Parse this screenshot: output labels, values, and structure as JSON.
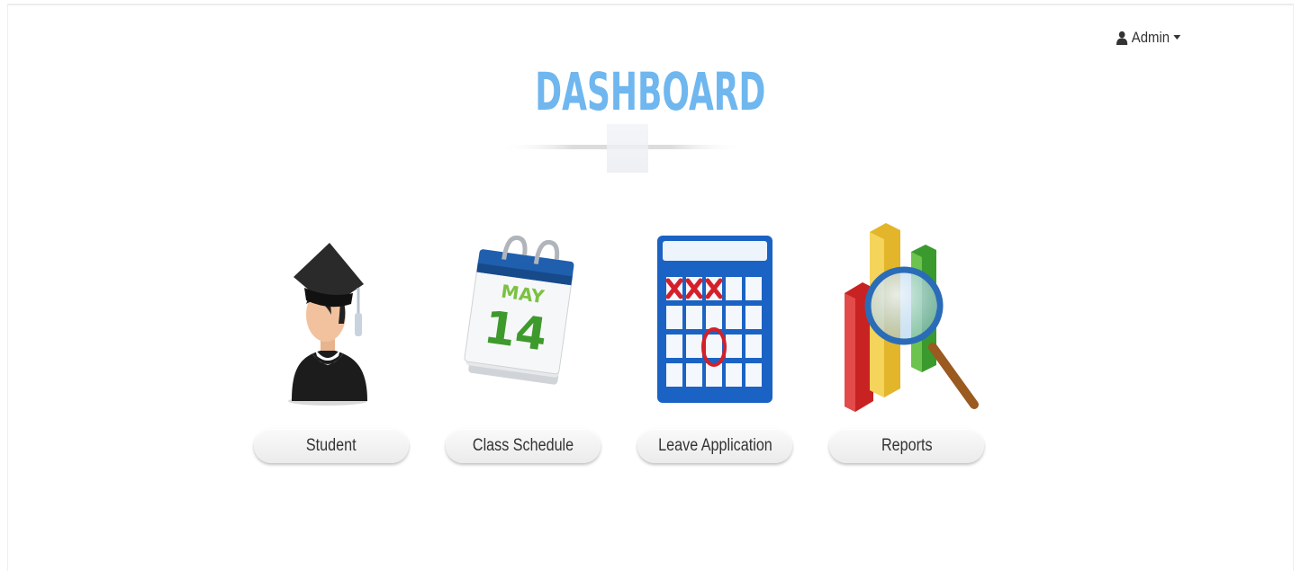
{
  "header": {
    "user_name": "Admin",
    "user_icon": "user-icon",
    "caret_icon": "caret-down-icon"
  },
  "page": {
    "title": "DASHBOARD",
    "title_color": "#6fb7ee"
  },
  "tiles": [
    {
      "label": "Student",
      "icon": "graduate-student-icon"
    },
    {
      "label": "Class Schedule",
      "icon": "calendar-page-icon",
      "icon_text_month": "MAY",
      "icon_text_day": "14"
    },
    {
      "label": "Leave Application",
      "icon": "calendar-grid-icon"
    },
    {
      "label": "Reports",
      "icon": "bar-chart-magnifier-icon"
    }
  ]
}
